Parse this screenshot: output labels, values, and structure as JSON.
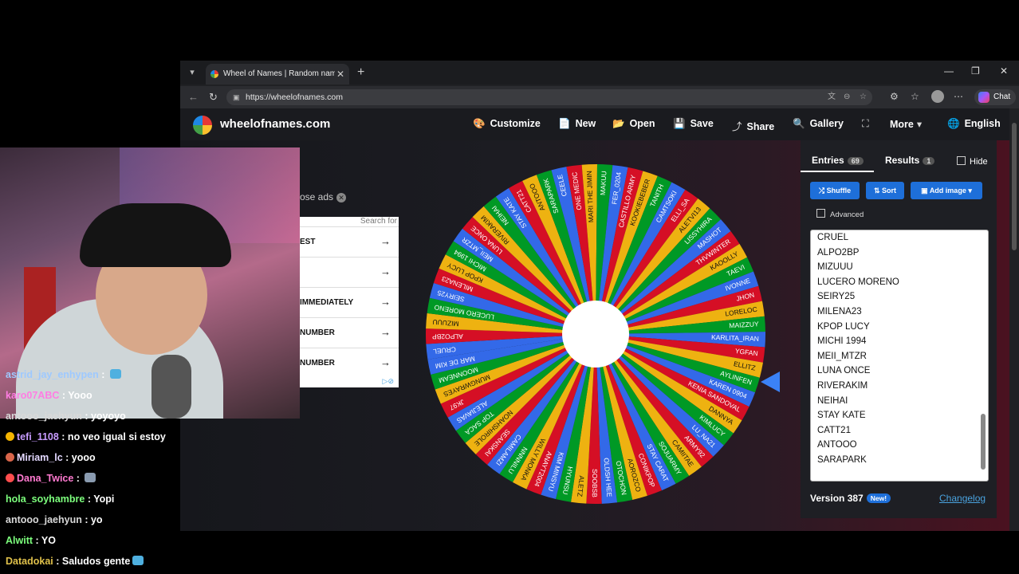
{
  "browser": {
    "tab_title": "Wheel of Names | Random name picker",
    "url": "https://wheelofnames.com",
    "chat_label": "Chat"
  },
  "site": {
    "title": "wheelofnames.com",
    "menu": [
      {
        "label": "Customize",
        "icon": "palette-icon",
        "glyph": "🎨"
      },
      {
        "label": "New",
        "icon": "file-icon",
        "glyph": "📄"
      },
      {
        "label": "Open",
        "icon": "folder-icon",
        "glyph": "📂"
      },
      {
        "label": "Save",
        "icon": "save-icon",
        "glyph": "💾"
      },
      {
        "label": "Share",
        "icon": "share-icon",
        "glyph": "⤴"
      },
      {
        "label": "Gallery",
        "icon": "search-icon",
        "glyph": "🔍"
      },
      {
        "label": "",
        "icon": "fullscreen-icon",
        "glyph": "⛶"
      },
      {
        "label": "More",
        "icon": "chevron-down-icon",
        "glyph": "▾"
      },
      {
        "label": "English",
        "icon": "globe-icon",
        "glyph": "🌐"
      }
    ]
  },
  "ad": {
    "close_label": "ose ads",
    "search_label": "Search for",
    "rows": [
      "EST",
      "",
      "IMMEDIATELY",
      "NUMBER",
      "NUMBER"
    ]
  },
  "wheel": {
    "colors": [
      "#3369e8",
      "#d50f25",
      "#eeb211",
      "#009925"
    ],
    "names": [
      "CRUEL",
      "ALPO2BP",
      "MIZUUU",
      "LUCERO MORENO",
      "SEIRY25",
      "MILENA23",
      "KPOP LUCY",
      "MICHI 1994",
      "MEII_MTZR",
      "LUNA ONCE",
      "RIVERAKIM",
      "NEIHAI",
      "STAY KATE",
      "CATT21",
      "ANTOOO",
      "SARAPARK",
      "CEELE",
      "ONE MEDIC",
      "MARI THE JIMIN",
      "MAKUU",
      "FER_0204",
      "CASTILLO ARMY",
      "KOOKIEBEBER",
      "TANITH",
      "CAMTSOKI",
      "ELLI_SA",
      "ALETVI13",
      "LISSYHIRA",
      "MASHOT",
      "THVWINTER",
      "KAOOLLY",
      "TAEVI",
      "IVONNE",
      "JHON",
      "LORELOC",
      "MAIZZUY",
      "KARLITA_IRAN",
      "YGFAN",
      "ELLITZ",
      "AYLINFEN",
      "KAREN 0904",
      "KENIA SANDOVAL",
      "DANNYA",
      "KIMLUCY",
      "LU_NA21",
      "ARMY92",
      "CAMIITAE",
      "SOJUARMY",
      "STAY CARAT",
      "CONIKPOP",
      "AOROZCO",
      "OTOCHON",
      "OLDSH HEE",
      "SOOBSB",
      "ALETZ",
      "HYUNSU",
      "KIM MINSYU",
      "ANAYT2004",
      "WILLY MONKA",
      "NNNNILU",
      "CAMILAMZI",
      "SEANSKAI",
      "NOAHSHIROLE",
      "TOP SACA",
      "ALEJIAVAS",
      "JK97",
      "MUNGWRAYES",
      "MOONNEAM",
      "MAR DE KIM"
    ]
  },
  "panel": {
    "tab_entries": "Entries",
    "entries_count": "69",
    "tab_results": "Results",
    "results_count": "1",
    "hide_label": "Hide",
    "shuffle_label": "Shuffle",
    "sort_label": "Sort",
    "add_image_label": "Add image",
    "advanced_label": "Advanced",
    "visible_entries": [
      "CRUEL",
      "ALPO2BP",
      "MIZUUU",
      "LUCERO MORENO",
      "SEIRY25",
      "MILENA23",
      "KPOP LUCY",
      "MICHI 1994",
      "MEII_MTZR",
      "LUNA ONCE",
      "RIVERAKIM",
      "NEIHAI",
      "STAY KATE",
      "CATT21",
      "ANTOOO",
      "SARAPARK"
    ],
    "version": "Version 387",
    "new_badge": "New!",
    "changelog": "Changelog"
  },
  "chat": [
    {
      "user": "astrid_jay_enhypen",
      "msg": " : ",
      "color": "#9ec9ff",
      "emote": "#4fb0e0"
    },
    {
      "user": "karo07ABC",
      "msg": " : Yooo",
      "color": "#ff7de3",
      "emote": ""
    },
    {
      "user": "antooo_jaehyun",
      "msg": " : yoyoyo",
      "color": "#d9d9d9",
      "emote": ""
    },
    {
      "user": "tefi_1108",
      "msg": " : no veo igual si estoy",
      "color": "#c89cff",
      "emote": "",
      "badge": "#f5b400"
    },
    {
      "user": "Miriam_lc",
      "msg": " : yooo",
      "color": "#e3d8ff",
      "emote": "",
      "badge": "#d9654a"
    },
    {
      "user": "Dana_Twice",
      "msg": " : ",
      "color": "#ff7ad0",
      "emote": "#8a9bb0",
      "badge": "#ff4d4d"
    },
    {
      "user": "hola_soyhambre",
      "msg": " : Yopi",
      "color": "#7dff7d",
      "emote": ""
    },
    {
      "user": "antooo_jaehyun",
      "msg": " : yo",
      "color": "#d9d9d9",
      "emote": ""
    },
    {
      "user": "Alwitt",
      "msg": " : YO",
      "color": "#7dff7d",
      "emote": ""
    },
    {
      "user": "Datadokai",
      "msg": " : Saludos gente",
      "color": "#e0c14b",
      "emote": "#4fb0e0"
    }
  ]
}
